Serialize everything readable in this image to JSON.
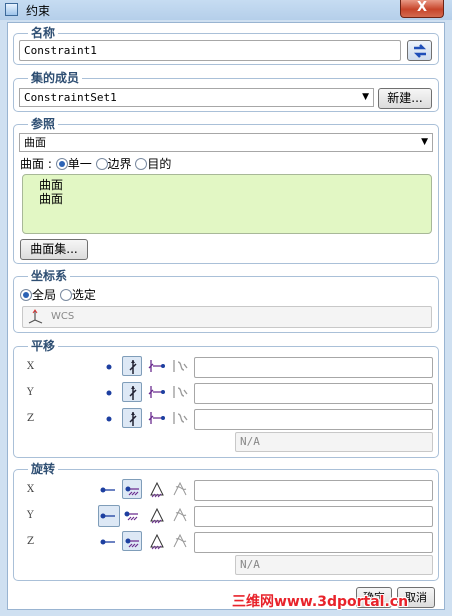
{
  "window": {
    "title": "约束",
    "close_label": "X"
  },
  "name_section": {
    "title": "名称",
    "value": "Constraint1"
  },
  "set_section": {
    "title": "集的成员",
    "selected": "ConstraintSet1",
    "new_button": "新建..."
  },
  "reference_section": {
    "title": "参照",
    "type_selected": "曲面",
    "surface_label": "曲面 :",
    "options": [
      "单一",
      "边界",
      "目的"
    ],
    "selected_option": "单一",
    "items": [
      "曲面",
      "曲面"
    ],
    "surface_set_button": "曲面集..."
  },
  "coord_section": {
    "title": "坐标系",
    "options": [
      "全局",
      "选定"
    ],
    "selected_option": "全局",
    "csys_value": "WCS"
  },
  "translation_section": {
    "title": "平移",
    "rows": [
      {
        "axis": "X",
        "value": ""
      },
      {
        "axis": "Y",
        "value": ""
      },
      {
        "axis": "Z",
        "value": ""
      }
    ],
    "na": "N/A"
  },
  "rotation_section": {
    "title": "旋转",
    "rows": [
      {
        "axis": "X",
        "value": ""
      },
      {
        "axis": "Y",
        "value": ""
      },
      {
        "axis": "Z",
        "value": ""
      }
    ],
    "na": "N/A"
  },
  "footer": {
    "ok": "确定",
    "cancel": "取消"
  },
  "watermark": "三维网www.3dportal.cn",
  "icons": {
    "swap": "blue-swap-icon",
    "free": "free-dot-icon",
    "fixed": "fixed-arrow-icon",
    "prescribed": "prescribed-icon",
    "function": "function-icon",
    "csys": "csys-icon"
  }
}
